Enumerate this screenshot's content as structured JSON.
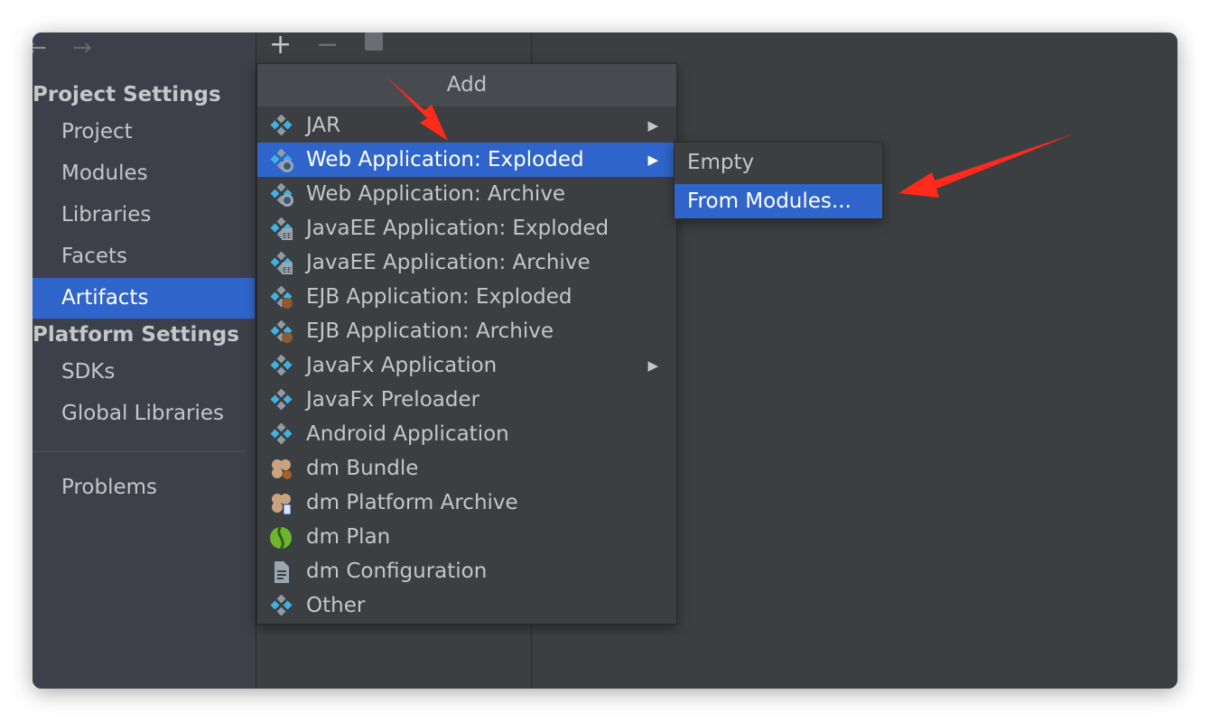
{
  "toolbar": {
    "back": "←",
    "forward": "→",
    "add": "+",
    "remove": "−"
  },
  "sidebar": {
    "project_settings": "Project Settings",
    "project_items": [
      {
        "label": "Project"
      },
      {
        "label": "Modules"
      },
      {
        "label": "Libraries"
      },
      {
        "label": "Facets"
      },
      {
        "label": "Artifacts",
        "selected": true
      }
    ],
    "platform_settings": "Platform Settings",
    "platform_items": [
      {
        "label": "SDKs"
      },
      {
        "label": "Global Libraries"
      }
    ],
    "problems": "Problems"
  },
  "popup": {
    "title": "Add",
    "items": [
      {
        "label": "JAR",
        "icon": "artifact-icon",
        "submenu": true
      },
      {
        "label": "Web Application: Exploded",
        "icon": "web-app-icon",
        "submenu": true,
        "selected": true
      },
      {
        "label": "Web Application: Archive",
        "icon": "web-app-icon"
      },
      {
        "label": "JavaEE Application: Exploded",
        "icon": "javaee-icon"
      },
      {
        "label": "JavaEE Application: Archive",
        "icon": "javaee-icon"
      },
      {
        "label": "EJB Application: Exploded",
        "icon": "ejb-icon"
      },
      {
        "label": "EJB Application: Archive",
        "icon": "ejb-icon"
      },
      {
        "label": "JavaFx Application",
        "icon": "artifact-icon",
        "submenu": true
      },
      {
        "label": "JavaFx Preloader",
        "icon": "artifact-icon"
      },
      {
        "label": "Android Application",
        "icon": "artifact-icon"
      },
      {
        "label": "dm Bundle",
        "icon": "dm-bundle-icon"
      },
      {
        "label": "dm Platform Archive",
        "icon": "dm-archive-icon"
      },
      {
        "label": "dm Plan",
        "icon": "dm-plan-icon"
      },
      {
        "label": "dm Configuration",
        "icon": "document-icon"
      },
      {
        "label": "Other",
        "icon": "artifact-icon"
      }
    ],
    "submenu_arrow": "▶"
  },
  "submenu": {
    "items": [
      {
        "label": "Empty"
      },
      {
        "label": "From Modules...",
        "selected": true
      }
    ]
  },
  "colors": {
    "selection": "#2f65ca",
    "annotation_arrow": "#ff2a1a",
    "icon_blue": "#3fb1e3"
  }
}
